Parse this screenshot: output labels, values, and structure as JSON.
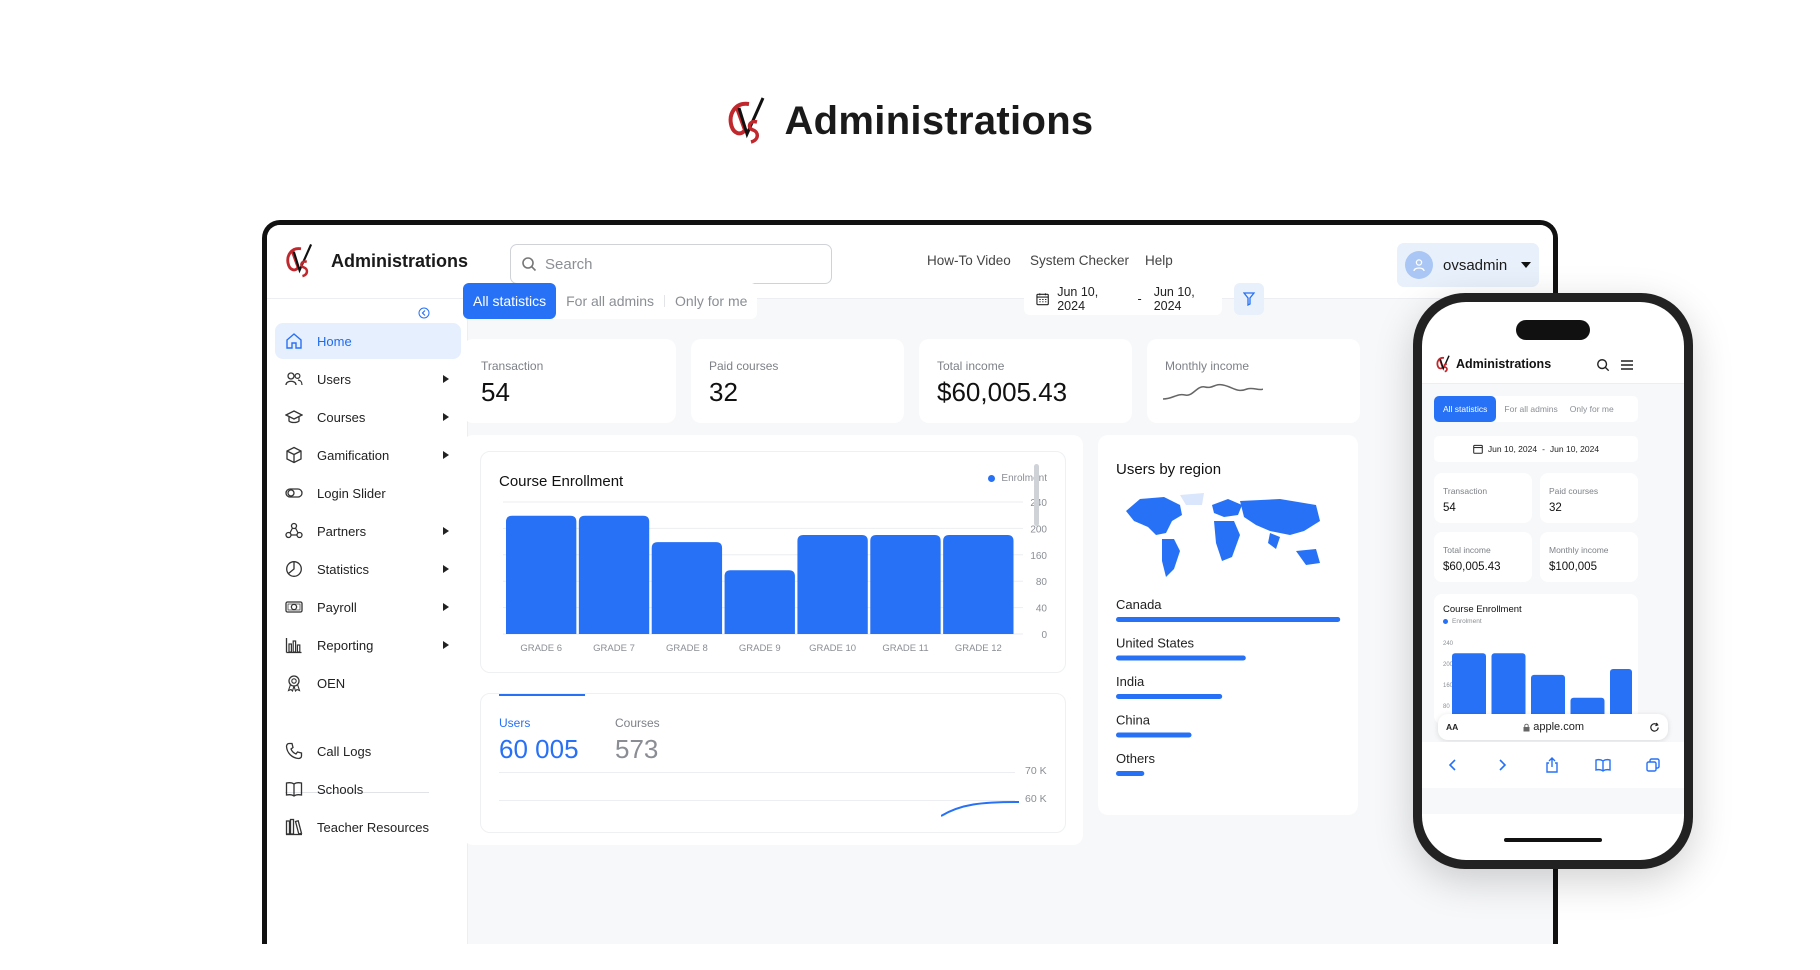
{
  "hero": {
    "title": "Administrations"
  },
  "app": {
    "brand_title": "Administrations",
    "search_placeholder": "Search",
    "top_links": [
      "How-To Video",
      "System Checker",
      "Help"
    ],
    "user": {
      "name": "ovsadmin"
    }
  },
  "sidebar": {
    "items": [
      {
        "label": "Home",
        "icon": "home-icon",
        "active": true,
        "expandable": false
      },
      {
        "label": "Users",
        "icon": "users-icon",
        "expandable": true
      },
      {
        "label": "Courses",
        "icon": "graduation-cap-icon",
        "expandable": true
      },
      {
        "label": "Gamification",
        "icon": "cube-icon",
        "expandable": true
      },
      {
        "label": "Login Slider",
        "icon": "toggle-icon",
        "expandable": false
      },
      {
        "label": "Partners",
        "icon": "partners-icon",
        "expandable": true
      },
      {
        "label": "Statistics",
        "icon": "pie-chart-icon",
        "expandable": true
      },
      {
        "label": "Payroll",
        "icon": "money-icon",
        "expandable": true
      },
      {
        "label": "Reporting",
        "icon": "bar-chart-icon",
        "expandable": true
      },
      {
        "label": "OEN",
        "icon": "badge-icon",
        "expandable": false
      }
    ],
    "secondary": [
      {
        "label": "Call Logs",
        "icon": "phone-icon"
      },
      {
        "label": "Schools",
        "icon": "book-icon"
      },
      {
        "label": "Teacher Resources",
        "icon": "library-icon"
      }
    ]
  },
  "filters": {
    "tabs": [
      "All statistics",
      "For all admins",
      "Only for me"
    ],
    "active_tab": "All statistics",
    "date_from": "Jun 10, 2024",
    "date_sep": "-",
    "date_to": "Jun 10, 2024"
  },
  "stats": [
    {
      "label": "Transaction",
      "value": "54"
    },
    {
      "label": "Paid courses",
      "value": "32"
    },
    {
      "label": "Total income",
      "value": "$60,005.43"
    },
    {
      "label": "Monthly income",
      "value": "$100,005"
    }
  ],
  "chart_data": [
    {
      "type": "bar",
      "title": "Course Enrollment",
      "categories": [
        "GRADE 6",
        "GRADE 7",
        "GRADE 8",
        "GRADE 9",
        "GRADE 10",
        "GRADE 11",
        "GRADE 12"
      ],
      "series": [
        {
          "name": "Enrolment",
          "values": [
            215,
            215,
            167,
            116,
            180,
            180,
            180
          ]
        }
      ],
      "yticks": [
        "240",
        "200",
        "160",
        "80",
        "40",
        "0"
      ],
      "ylim": [
        0,
        240
      ],
      "legend": "top-right",
      "grid": true
    },
    {
      "type": "bar",
      "title": "Users by region",
      "categories": [
        "Canada",
        "United States",
        "India",
        "China",
        "Others"
      ],
      "values": [
        0.95,
        0.55,
        0.45,
        0.32,
        0.12
      ]
    }
  ],
  "totals": {
    "tabs": [
      {
        "label": "Users",
        "value": "60 005"
      },
      {
        "label": "Courses",
        "value": "573"
      }
    ],
    "yticks": [
      "70 K",
      "60 K"
    ]
  },
  "phone": {
    "brand_title": "Administrations",
    "tabs": [
      "All statistics",
      "For all admins",
      "Only for me"
    ],
    "date_from": "Jun 10, 2024",
    "date_sep": "-",
    "date_to": "Jun 10, 2024",
    "chart_title": "Course Enrollment",
    "legend": "Enrolment",
    "yticks": [
      "240",
      "200",
      "160",
      "80"
    ],
    "url_size": "AA",
    "url": "apple.com"
  },
  "colors": {
    "accent": "#2771f6",
    "active_bg": "#e6effd",
    "logo_red": "#c0282d"
  }
}
